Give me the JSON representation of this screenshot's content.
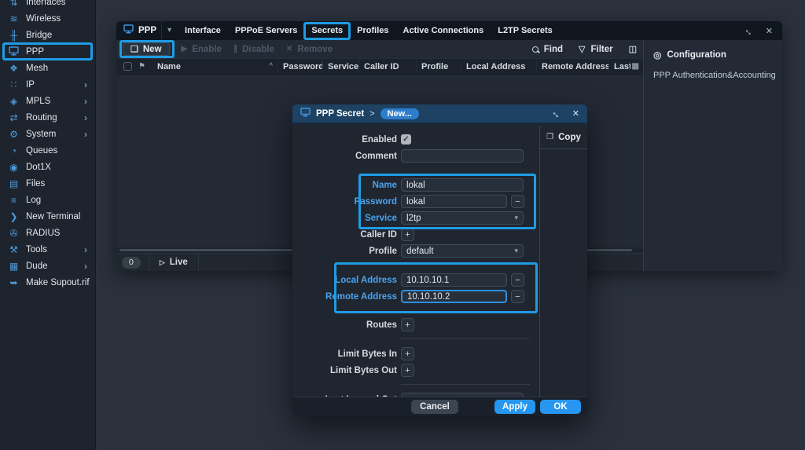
{
  "colors": {
    "annotation_blue": "#1e9ce4",
    "accent_blue": "#2796f0",
    "dialog_titlebar_blue": "#1e4263",
    "modified_label_blue": "#4aa3f0"
  },
  "sidebar": {
    "items": [
      {
        "label": "Interfaces",
        "icon": "interfaces-icon",
        "glyph": "⇅"
      },
      {
        "label": "Wireless",
        "icon": "wireless-icon",
        "glyph": "≋"
      },
      {
        "label": "Bridge",
        "icon": "bridge-icon",
        "glyph": "╫"
      },
      {
        "label": "PPP",
        "icon": "ppp-icon",
        "glyph": "",
        "annotated": true
      },
      {
        "label": "Mesh",
        "icon": "mesh-icon",
        "glyph": "❖"
      },
      {
        "label": "IP",
        "icon": "ip-icon",
        "glyph": "∷",
        "submenu": true
      },
      {
        "label": "MPLS",
        "icon": "mpls-icon",
        "glyph": "◈",
        "submenu": true
      },
      {
        "label": "Routing",
        "icon": "routing-icon",
        "glyph": "⇄",
        "submenu": true
      },
      {
        "label": "System",
        "icon": "system-gear-icon",
        "glyph": "⚙",
        "submenu": true
      },
      {
        "label": "Queues",
        "icon": "queues-gauge-icon",
        "glyph": "◔"
      },
      {
        "label": "Dot1X",
        "icon": "dot1x-shield-icon",
        "glyph": "◉"
      },
      {
        "label": "Files",
        "icon": "files-folder-icon",
        "glyph": "▤"
      },
      {
        "label": "Log",
        "icon": "log-icon",
        "glyph": "≡"
      },
      {
        "label": "New Terminal",
        "icon": "terminal-icon",
        "glyph": "❯"
      },
      {
        "label": "RADIUS",
        "icon": "radius-key-icon",
        "glyph": "✇"
      },
      {
        "label": "Tools",
        "icon": "tools-icon",
        "glyph": "⚒",
        "submenu": true
      },
      {
        "label": "Dude",
        "icon": "dude-icon",
        "glyph": "▦",
        "submenu": true
      },
      {
        "label": "Make Supout.rif",
        "icon": "supout-icon",
        "glyph": "➥"
      }
    ]
  },
  "window": {
    "menu_label": "PPP",
    "tabs": [
      "Interface",
      "PPPoE Servers",
      "Secrets",
      "Profiles",
      "Active Connections",
      "L2TP Secrets"
    ],
    "annotated_tab": "Secrets",
    "toolbar": {
      "new": "New",
      "enable": "Enable",
      "disable": "Disable",
      "remove": "Remove",
      "find": "Find",
      "filter": "Filter"
    },
    "table": {
      "columns": [
        "Name",
        "Password",
        "Service",
        "Caller ID",
        "Profile",
        "Local Address",
        "Remote Address",
        "Last L"
      ],
      "sort_column": "Name"
    },
    "status": {
      "count": "0",
      "live": "Live"
    }
  },
  "config_panel": {
    "title": "Configuration",
    "items": [
      "PPP Authentication&Accounting"
    ]
  },
  "dialog": {
    "title": "PPP Secret",
    "separator": ">",
    "badge": "New...",
    "copy_label": "Copy",
    "rows": [
      {
        "key": "enabled",
        "label": "Enabled",
        "type": "checkbox",
        "checked": true
      },
      {
        "key": "comment",
        "label": "Comment",
        "type": "text",
        "value": ""
      },
      {
        "key": "name",
        "label": "Name",
        "type": "text",
        "value": "lokal",
        "modified": true
      },
      {
        "key": "password",
        "label": "Password",
        "type": "text",
        "value": "lokal",
        "modified": true,
        "minus": true
      },
      {
        "key": "service",
        "label": "Service",
        "type": "select",
        "value": "l2tp",
        "modified": true
      },
      {
        "key": "caller_id",
        "label": "Caller ID",
        "type": "plus"
      },
      {
        "key": "profile",
        "label": "Profile",
        "type": "select",
        "value": "default"
      },
      {
        "key": "local_address",
        "label": "Local Address",
        "type": "text",
        "value": "10.10.10.1",
        "modified": true,
        "minus": true
      },
      {
        "key": "remote_address",
        "label": "Remote Address",
        "type": "text",
        "value": "10.10.10.2",
        "modified": true,
        "minus": true,
        "focused": true
      },
      {
        "key": "routes",
        "label": "Routes",
        "type": "plus"
      },
      {
        "sep": true
      },
      {
        "key": "limit_bytes_in",
        "label": "Limit Bytes In",
        "type": "plus"
      },
      {
        "key": "limit_bytes_out",
        "label": "Limit Bytes Out",
        "type": "plus"
      },
      {
        "sep": true
      },
      {
        "key": "last_logged_out",
        "label": "Last Logged Out",
        "type": "text",
        "value": ""
      }
    ],
    "footer": {
      "cancel": "Cancel",
      "apply": "Apply",
      "ok": "OK"
    }
  }
}
